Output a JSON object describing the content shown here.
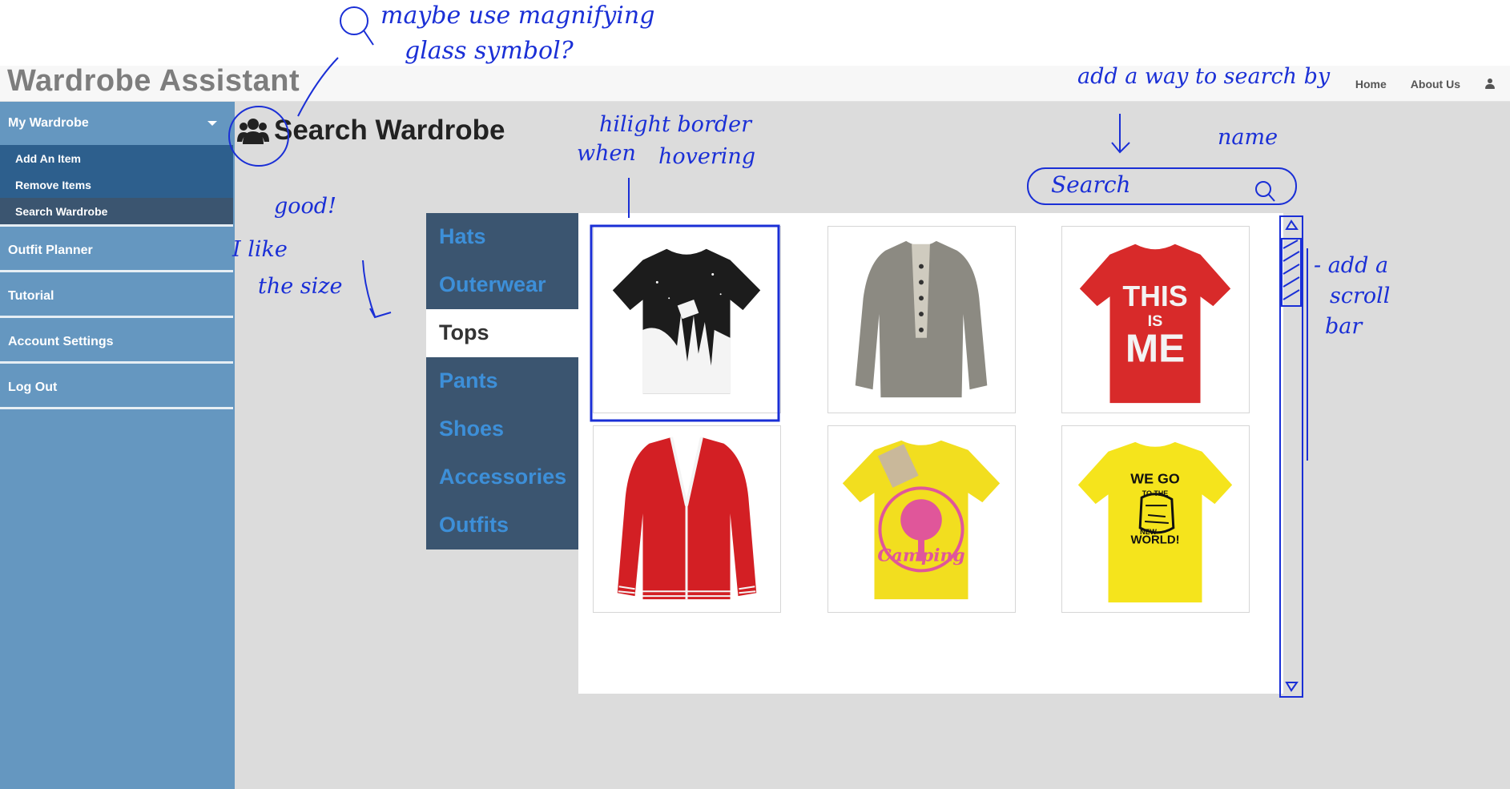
{
  "app": {
    "title": "Wardrobe Assistant",
    "nav": [
      "Home",
      "About Us"
    ],
    "user_icon": "user-icon"
  },
  "sidebar": {
    "section": {
      "label": "My Wardrobe",
      "items": [
        "Add An Item",
        "Remove Items",
        "Search Wardrobe"
      ],
      "active": "Search Wardrobe"
    },
    "items": [
      "Outfit Planner",
      "Tutorial",
      "Account Settings",
      "Log Out"
    ]
  },
  "page": {
    "title": "Search Wardrobe",
    "title_icon": "users-icon"
  },
  "categories": {
    "items": [
      "Hats",
      "Outerwear",
      "Tops",
      "Pants",
      "Shoes",
      "Accessories",
      "Outfits"
    ],
    "active": "Tops"
  },
  "grid": {
    "items": [
      {
        "name": "black-white-paint-tshirt",
        "color": "#1c1c1c"
      },
      {
        "name": "grey-henley-longsleeve",
        "color": "#8c8a82"
      },
      {
        "name": "red-this-is-me-tshirt",
        "color": "#d82a2a"
      },
      {
        "name": "red-cardigan",
        "color": "#d31f24"
      },
      {
        "name": "yellow-camping-tshirt",
        "color": "#f2de1f"
      },
      {
        "name": "yellow-we-go-tshirt",
        "color": "#f5e41c"
      }
    ],
    "print_text": {
      "this_is_me": [
        "THIS",
        "IS",
        "ME"
      ],
      "camping": "Camping",
      "we_go": [
        "WE GO",
        "TO THE",
        "NEW",
        "WORLD!"
      ]
    }
  },
  "annotations": {
    "magnifier": [
      "maybe use magnifying",
      "glass symbol?"
    ],
    "hover": [
      "hilight border",
      "when",
      "hovering"
    ],
    "good": [
      "good!",
      "I like",
      "the size"
    ],
    "search_hint": [
      "add a way to search by",
      "name"
    ],
    "search_placeholder": "Search",
    "scroll": [
      "- add a",
      "scroll",
      "bar"
    ]
  },
  "colors": {
    "sidebar": "#6597c0",
    "sidebar_sub": "#2d5f8d",
    "sidebar_active": "#3b5570",
    "category_bg": "#3b5570",
    "category_text": "#3d8fd8",
    "annotation_ink": "#1a2fd6"
  }
}
